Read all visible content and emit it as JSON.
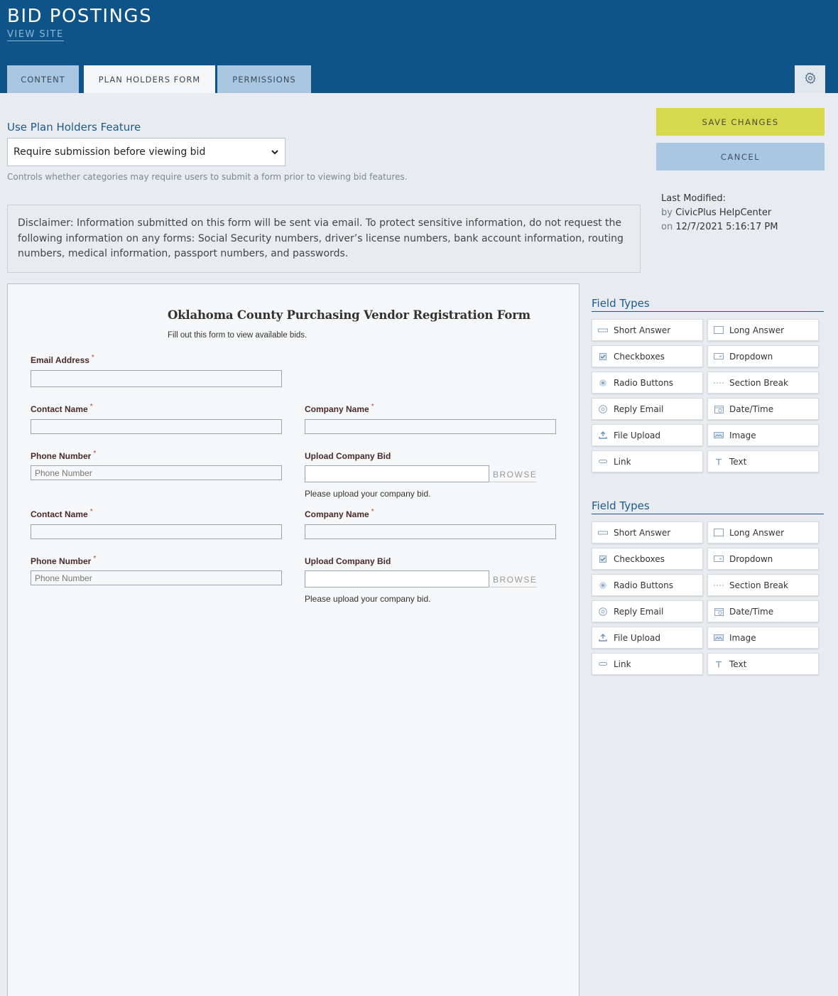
{
  "header": {
    "title": "BID POSTINGS",
    "view_site": "VIEW SITE",
    "tabs": [
      {
        "label": "CONTENT"
      },
      {
        "label": "PLAN HOLDERS FORM"
      },
      {
        "label": "PERMISSIONS"
      }
    ]
  },
  "feature": {
    "label": "Use Plan Holders Feature",
    "selected": "Require submission before viewing bid",
    "help": "Controls whether categories may require users to submit a form prior to viewing bid features."
  },
  "actions": {
    "save": "SAVE CHANGES",
    "cancel": "CANCEL"
  },
  "modified": {
    "label": "Last Modified:",
    "by_prefix": "by",
    "by": "CivicPlus HelpCenter",
    "on_prefix": "on",
    "on": "12/7/2021 5:16:17 PM"
  },
  "disclaimer": "Disclaimer: Information submitted on this form will be sent via email. To protect sensitive information, do not request the following information on any forms: Social Security numbers, driver’s license numbers, bank account information, routing numbers, medical information, passport numbers, and passwords.",
  "form": {
    "title": "Oklahoma County Purchasing Vendor Registration Form",
    "subtitle": "Fill out this form to view available bids.",
    "required_mark": "*",
    "email_label": "Email Address",
    "rows": [
      {
        "contact_label": "Contact Name",
        "company_label": "Company Name",
        "phone_label": "Phone Number",
        "phone_placeholder": "Phone Number",
        "upload_label": "Upload Company Bid",
        "browse": "BROWSE",
        "upload_help": "Please upload your company bid."
      },
      {
        "contact_label": "Contact Name",
        "company_label": "Company Name",
        "phone_label": "Phone Number",
        "phone_placeholder": "Phone Number",
        "upload_label": "Upload Company Bid",
        "browse": "BROWSE",
        "upload_help": "Please upload your company bid."
      }
    ]
  },
  "field_type_panels": [
    {
      "title": "Field Types",
      "items": [
        {
          "label": "Short Answer",
          "icon": "short-answer-icon"
        },
        {
          "label": "Long Answer",
          "icon": "long-answer-icon"
        },
        {
          "label": "Checkboxes",
          "icon": "checkbox-icon"
        },
        {
          "label": "Dropdown",
          "icon": "dropdown-icon"
        },
        {
          "label": "Radio Buttons",
          "icon": "radio-icon"
        },
        {
          "label": "Section Break",
          "icon": "section-break-icon"
        },
        {
          "label": "Reply Email",
          "icon": "at-icon"
        },
        {
          "label": "Date/Time",
          "icon": "calendar-icon"
        },
        {
          "label": "File Upload",
          "icon": "upload-icon"
        },
        {
          "label": "Image",
          "icon": "image-icon"
        },
        {
          "label": "Link",
          "icon": "link-icon"
        },
        {
          "label": "Text",
          "icon": "text-icon"
        }
      ]
    },
    {
      "title": "Field Types",
      "items": [
        {
          "label": "Short Answer",
          "icon": "short-answer-icon"
        },
        {
          "label": "Long Answer",
          "icon": "long-answer-icon"
        },
        {
          "label": "Checkboxes",
          "icon": "checkbox-icon"
        },
        {
          "label": "Dropdown",
          "icon": "dropdown-icon"
        },
        {
          "label": "Radio Buttons",
          "icon": "radio-icon"
        },
        {
          "label": "Section Break",
          "icon": "section-break-icon"
        },
        {
          "label": "Reply Email",
          "icon": "at-icon"
        },
        {
          "label": "Date/Time",
          "icon": "calendar-icon"
        },
        {
          "label": "File Upload",
          "icon": "upload-icon"
        },
        {
          "label": "Image",
          "icon": "image-icon"
        },
        {
          "label": "Link",
          "icon": "link-icon"
        },
        {
          "label": "Text",
          "icon": "text-icon"
        }
      ]
    }
  ],
  "colors": {
    "header_bg": "#0e5488",
    "tab_bg": "#a9c7e3",
    "save_bg": "#d6d84e",
    "accent_text": "#1d5a8a",
    "required": "#c23a3a"
  }
}
